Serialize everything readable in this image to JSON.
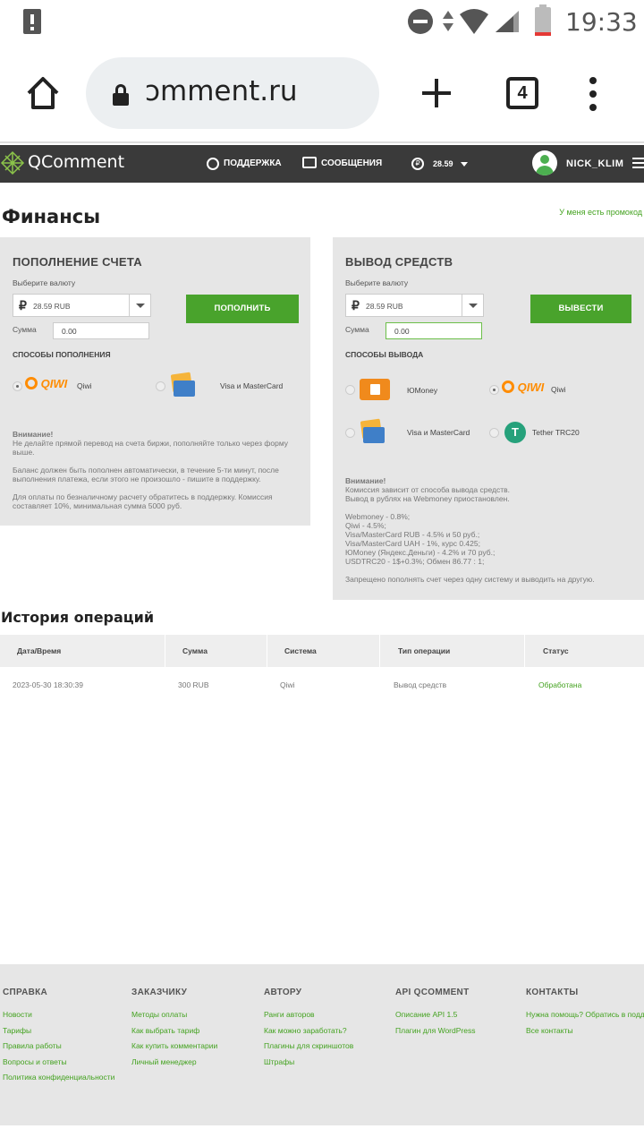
{
  "status_bar": {
    "time": "19:33"
  },
  "browser": {
    "url": "ɔmment.ru",
    "tabs_count": "4"
  },
  "topnav": {
    "logo": "QComment",
    "support": "ПОДДЕРЖКА",
    "messages": "СООБЩЕНИЯ",
    "balance": "28.59",
    "username": "NICK_KLIM"
  },
  "page": {
    "title": "Финансы",
    "promo_link": "У меня есть промокод"
  },
  "deposit": {
    "title": "ПОПОЛНЕНИЕ СЧЕТА",
    "currency_label": "Выберите валюту",
    "currency_value": "28.59 RUB",
    "sum_label": "Сумма",
    "sum_value": "0.00",
    "button": "ПОПОЛНИТЬ",
    "methods_title": "СПОСОБЫ ПОПОЛНЕНИЯ",
    "methods": [
      {
        "name": "Qiwi",
        "logo": "QIWI",
        "selected": true
      },
      {
        "name": "Visa и MasterCard",
        "logo": "wallet-card-icon",
        "selected": false
      }
    ],
    "notice_title": "Внимание!",
    "notice_lines": [
      "Не делайте прямой перевод на счета биржи, пополняйте только через форму",
      "выше.",
      "Баланс должен быть пополнен автоматически, в течение 5-ти минут, после",
      "выполнения платежа, если этого не произошло - пишите в поддержку.",
      "Для оплаты по безналичному расчету обратитесь в поддержку. Комиссия",
      "составляет 10%, минимальная сумма 5000 руб."
    ]
  },
  "withdraw": {
    "title": "ВЫВОД СРЕДСТВ",
    "currency_label": "Выберите валюту",
    "currency_value": "28.59 RUB",
    "sum_label": "Сумма",
    "sum_value": "0.00",
    "button": "ВЫВЕСТИ",
    "methods_title": "СПОСОБЫ ВЫВОДА",
    "methods": [
      {
        "name": "ЮMoney",
        "logo": "yoomoney-icon",
        "selected": false
      },
      {
        "name": "Qiwi",
        "logo": "QIWI",
        "selected": true
      },
      {
        "name": "Visa и MasterCard",
        "logo": "wallet-card-icon",
        "selected": false
      },
      {
        "name": "Tether TRC20",
        "logo": "tether-icon",
        "selected": false
      }
    ],
    "notice_title": "Внимание!",
    "notice_lines": [
      "Комиссия зависит от способа вывода средств.",
      "Вывод в рублях на Webmoney приостановлен."
    ],
    "fees": [
      "Webmoney - 0.8%;",
      "Qiwi - 4.5%;",
      "Visa/MasterCard RUB - 4.5% и 50 руб.;",
      "Visa/MasterCard UAH - 1%, курс 0.425;",
      "ЮMoney (Яндекс.Деньги) - 4.2% и 70 руб.;",
      "USDTRC20 - 1$+0.3%; Обмен 86.77 : 1;"
    ],
    "warning": "Запрещено пополнять счет через одну систему и выводить на другую."
  },
  "history": {
    "title": "История операций",
    "columns": [
      "Дата/Время",
      "Сумма",
      "Система",
      "Тип операции",
      "Статус"
    ],
    "rows": [
      {
        "datetime": "2023-05-30 18:30:39",
        "amount": "300 RUB",
        "system": "Qiwi",
        "type": "Вывод средств",
        "status": "Обработана"
      }
    ]
  },
  "footer": {
    "columns": [
      {
        "title": "СПРАВКА",
        "links": [
          "Новости",
          "Тарифы",
          "Правила работы",
          "Вопросы и ответы",
          "Политика конфиденциальности"
        ]
      },
      {
        "title": "ЗАКАЗЧИКУ",
        "links": [
          "Методы оплаты",
          "Как выбрать тариф",
          "Как купить комментарии",
          "Личный менеджер"
        ]
      },
      {
        "title": "АВТОРУ",
        "links": [
          "Ранги авторов",
          "Как можно заработать?",
          "Плагины для скриншотов",
          "Штрафы"
        ]
      },
      {
        "title": "API QCOMMENT",
        "links": [
          "Описание API 1.5",
          "Плагин для WordPress"
        ]
      },
      {
        "title": "КОНТАКТЫ",
        "links": [
          "Нужна помощь? Обратись в поддержку",
          "Все контакты"
        ]
      }
    ]
  },
  "colors": {
    "accent_green": "#49a32c",
    "nav_dark": "#3a3a3a",
    "link_green": "#43a21f"
  }
}
